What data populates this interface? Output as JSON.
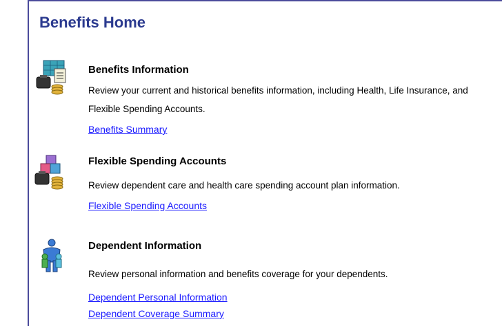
{
  "page": {
    "title": "Benefits Home"
  },
  "sections": [
    {
      "heading": "Benefits Information",
      "description": "Review your current and historical benefits information, including Health, Life Insurance, and Flexible Spending Accounts.",
      "links": [
        "Benefits Summary"
      ],
      "icon": "benefits-info-icon"
    },
    {
      "heading": "Flexible Spending Accounts",
      "description": "Review dependent care and health care spending account plan information.",
      "links": [
        "Flexible Spending Accounts"
      ],
      "icon": "flexible-spending-icon"
    },
    {
      "heading": "Dependent Information",
      "description": "Review personal information and benefits coverage for your dependents.",
      "links": [
        "Dependent Personal Information",
        "Dependent Coverage Summary"
      ],
      "icon": "dependent-info-icon"
    }
  ]
}
